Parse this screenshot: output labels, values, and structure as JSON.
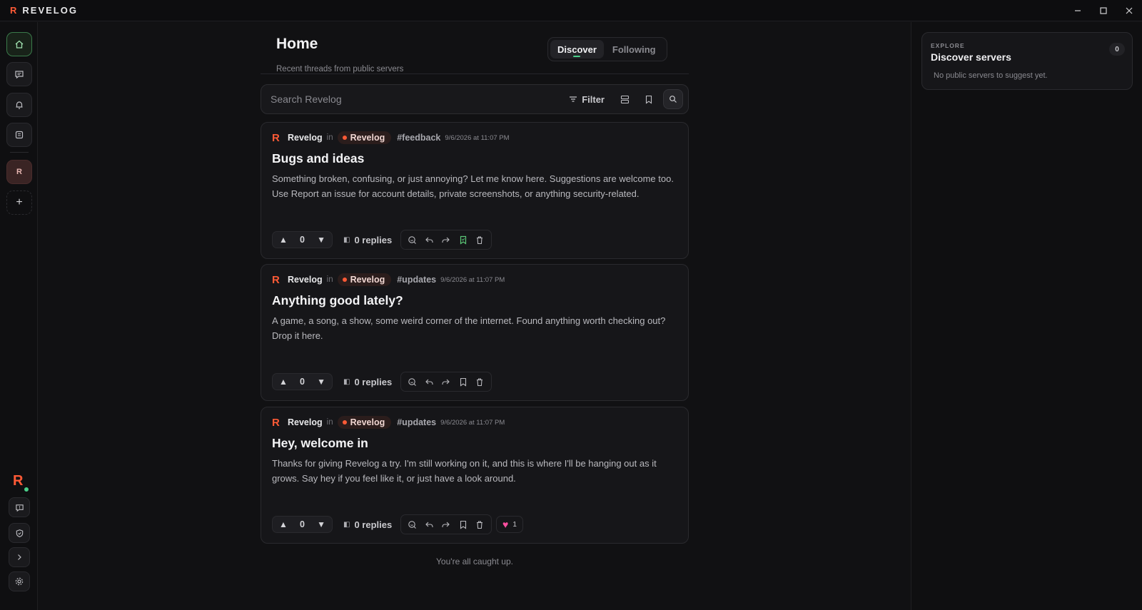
{
  "titlebar": {
    "brand_mark": "R",
    "brand_name": "REVELOG",
    "minimize": "–",
    "maximize": "▢",
    "close": "✕"
  },
  "rail": {
    "server_initial": "R",
    "add": "+",
    "user_logo": "R",
    "icons": [
      "home-icon",
      "messages-icon",
      "bell-icon",
      "feed-icon",
      "feedback-icon",
      "shield-icon",
      "chevron-right-icon",
      "gear-icon"
    ]
  },
  "header": {
    "title": "Home",
    "subtitle": "Recent threads from public servers",
    "tabs": [
      {
        "label": "Discover",
        "active": true
      },
      {
        "label": "Following",
        "active": false
      }
    ]
  },
  "search": {
    "placeholder": "Search Revelog",
    "filter_label": "Filter"
  },
  "posts": [
    {
      "author": "Revelog",
      "in": "in",
      "server": "Revelog",
      "channel": "#feedback",
      "timestamp": "9/6/2026 at 11:07 PM",
      "title": "Bugs and ideas",
      "body": "Something broken, confusing, or just annoying? Let me know here. Suggestions are welcome too. Use Report an issue for account details, private screenshots, or anything security-related.",
      "votes": "0",
      "replies": "0 replies",
      "saved": true
    },
    {
      "author": "Revelog",
      "in": "in",
      "server": "Revelog",
      "channel": "#updates",
      "timestamp": "9/6/2026 at 11:07 PM",
      "title": "Anything good lately?",
      "body": "A game, a song, a show, some weird corner of the internet. Found anything worth checking out? Drop it here.",
      "votes": "0",
      "replies": "0 replies",
      "saved": false
    },
    {
      "author": "Revelog",
      "in": "in",
      "server": "Revelog",
      "channel": "#updates",
      "timestamp": "9/6/2026 at 11:07 PM",
      "title": "Hey, welcome in",
      "body": "Thanks for giving Revelog a try. I'm still working on it, and this is where I'll be hanging out as it grows. Say hey if you feel like it, or just have a look around.",
      "votes": "0",
      "replies": "0 replies",
      "saved": false,
      "reaction": {
        "emoji": "heart",
        "count": "1"
      }
    }
  ],
  "feed_end": "You're all caught up.",
  "explore": {
    "kicker": "EXPLORE",
    "title": "Discover servers",
    "count": "0",
    "empty": "No public servers to suggest yet."
  },
  "colors": {
    "accent": "#ff5a36",
    "online": "#4ad08a",
    "saved": "#5cc878",
    "heart": "#ff4fa0"
  }
}
